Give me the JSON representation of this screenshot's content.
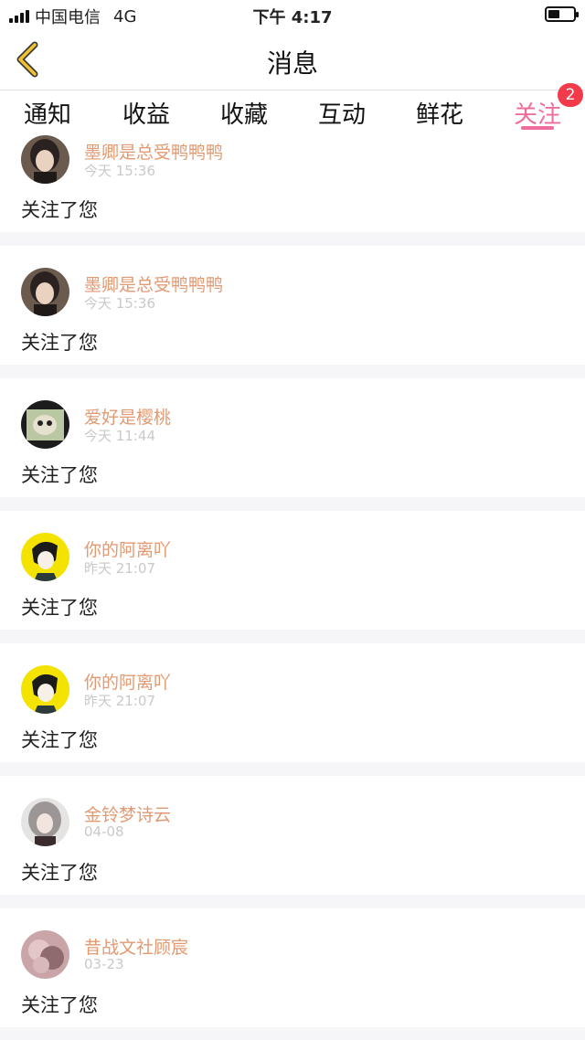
{
  "status_bar": {
    "carrier": "中国电信",
    "network": "4G",
    "time": "下午 4:17"
  },
  "header": {
    "title": "消息",
    "back_icon": "chevron-left-icon"
  },
  "tabs": [
    {
      "label": "通知"
    },
    {
      "label": "收益"
    },
    {
      "label": "收藏"
    },
    {
      "label": "互动"
    },
    {
      "label": "鲜花"
    },
    {
      "label": "关注",
      "active": true,
      "badge": "2"
    }
  ],
  "notifications": [
    {
      "name": "墨卿是总受鸭鸭鸭",
      "time": "今天 15:36",
      "message": "关注了您",
      "avatar": "dark-hair-avatar"
    },
    {
      "name": "墨卿是总受鸭鸭鸭",
      "time": "今天 15:36",
      "message": "关注了您",
      "avatar": "dark-hair-avatar"
    },
    {
      "name": "爱好是樱桃",
      "time": "今天 11:44",
      "message": "关注了您",
      "avatar": "cartoon-cat-avatar"
    },
    {
      "name": "你的阿离吖",
      "time": "昨天 21:07",
      "message": "关注了您",
      "avatar": "yellow-anime-avatar"
    },
    {
      "name": "你的阿离吖",
      "time": "昨天 21:07",
      "message": "关注了您",
      "avatar": "yellow-anime-avatar"
    },
    {
      "name": "金铃梦诗云",
      "time": "04-08",
      "message": "关注了您",
      "avatar": "silver-hair-avatar"
    },
    {
      "name": "昔战文社顾宸",
      "time": "03-23",
      "message": "关注了您",
      "avatar": "pink-blur-avatar"
    }
  ],
  "colors": {
    "accent": "#ef6d9c",
    "name": "#e29a73",
    "badge": "#f23b4a",
    "back_arrow": "#f2c230"
  }
}
